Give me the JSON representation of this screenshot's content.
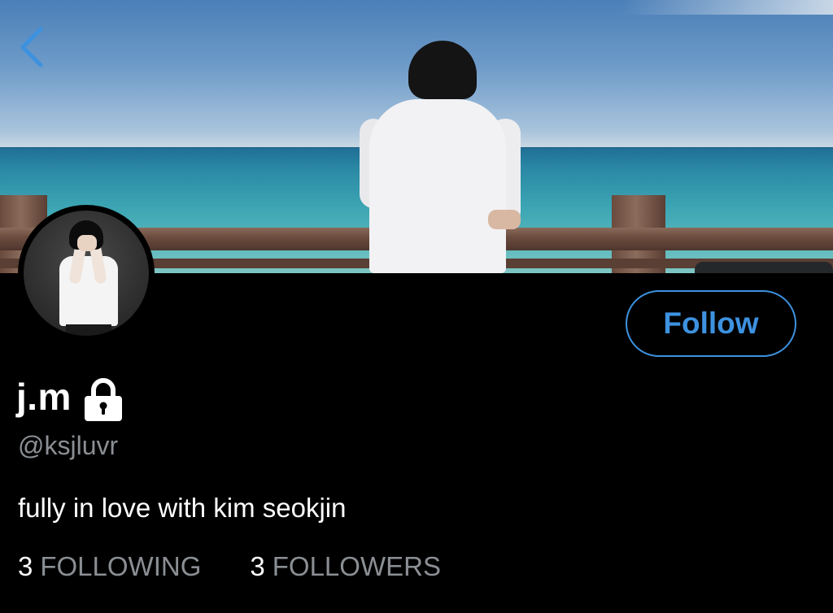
{
  "profile": {
    "display_name": "j.m",
    "handle": "@ksjluvr",
    "bio": "fully in love with kim seokjin",
    "protected": true
  },
  "actions": {
    "follow_label": "Follow"
  },
  "stats": {
    "following_count": "3",
    "following_label": "FOLLOWING",
    "followers_count": "3",
    "followers_label": "FOLLOWERS"
  },
  "icons": {
    "back": "chevron-left-icon",
    "protected": "lock-icon"
  },
  "colors": {
    "accent": "#3d92e0",
    "background": "#000000",
    "secondary_text": "#8b8f94",
    "primary_text": "#ffffff"
  }
}
